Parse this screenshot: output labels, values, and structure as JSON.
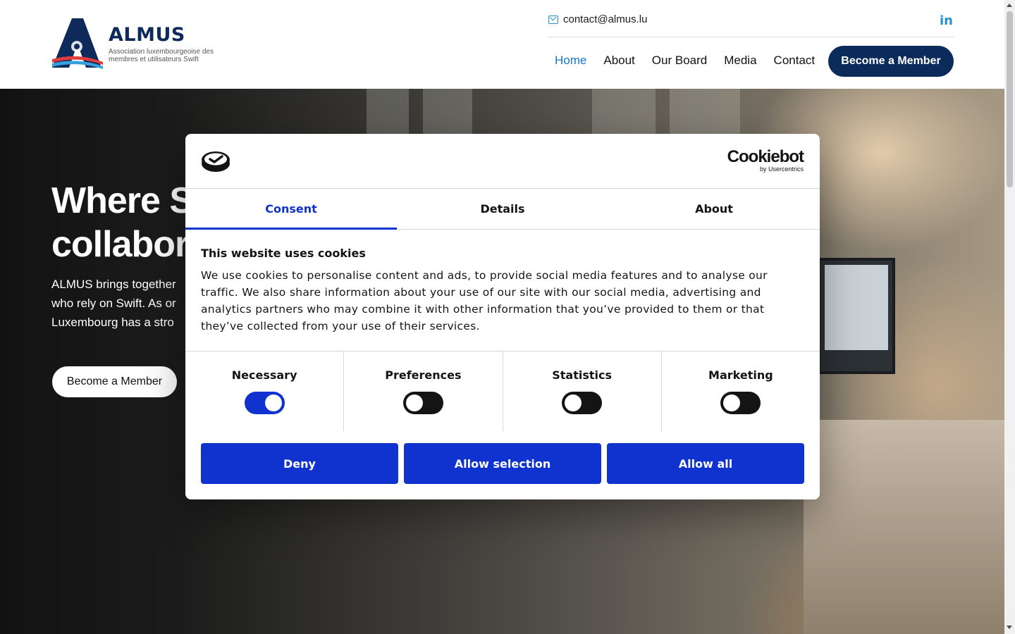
{
  "header": {
    "logo_title": "ALMUS",
    "logo_subtitle": "Association luxembourgeoise des membres et utilisateurs Swift",
    "contact_email": "contact@almus.lu",
    "linkedin_label": "in",
    "nav": [
      {
        "label": "Home",
        "active": true
      },
      {
        "label": "About",
        "active": false
      },
      {
        "label": "Our Board",
        "active": false
      },
      {
        "label": "Media",
        "active": false
      },
      {
        "label": "Contact",
        "active": false
      }
    ],
    "cta_label": "Become a Member"
  },
  "hero": {
    "title_line1": "Where S",
    "title_line2": "collabora",
    "text_line1": "ALMUS brings together",
    "text_line2": "who rely on Swift. As or",
    "text_line3": "Luxembourg has a stro",
    "cta_label": "Become a Member"
  },
  "cookie_dialog": {
    "brand_name": "Cookiebot",
    "brand_by": "by Usercentrics",
    "tabs": [
      {
        "label": "Consent",
        "active": true
      },
      {
        "label": "Details",
        "active": false
      },
      {
        "label": "About",
        "active": false
      }
    ],
    "heading": "This website uses cookies",
    "body": "We use cookies to personalise content and ads, to provide social media features and to analyse our traffic. We also share information about your use of our site with our social media, advertising and analytics partners who may combine it with other information that you’ve provided to them or that they’ve collected from your use of their services.",
    "toggles": [
      {
        "label": "Necessary",
        "on": true
      },
      {
        "label": "Preferences",
        "on": false
      },
      {
        "label": "Statistics",
        "on": false
      },
      {
        "label": "Marketing",
        "on": false
      }
    ],
    "buttons": {
      "deny": "Deny",
      "allow_selection": "Allow selection",
      "allow_all": "Allow all"
    }
  },
  "colors": {
    "brand_navy": "#0b2b5b",
    "nav_active": "#1777c7",
    "cookiebot_blue": "#1032cf"
  }
}
